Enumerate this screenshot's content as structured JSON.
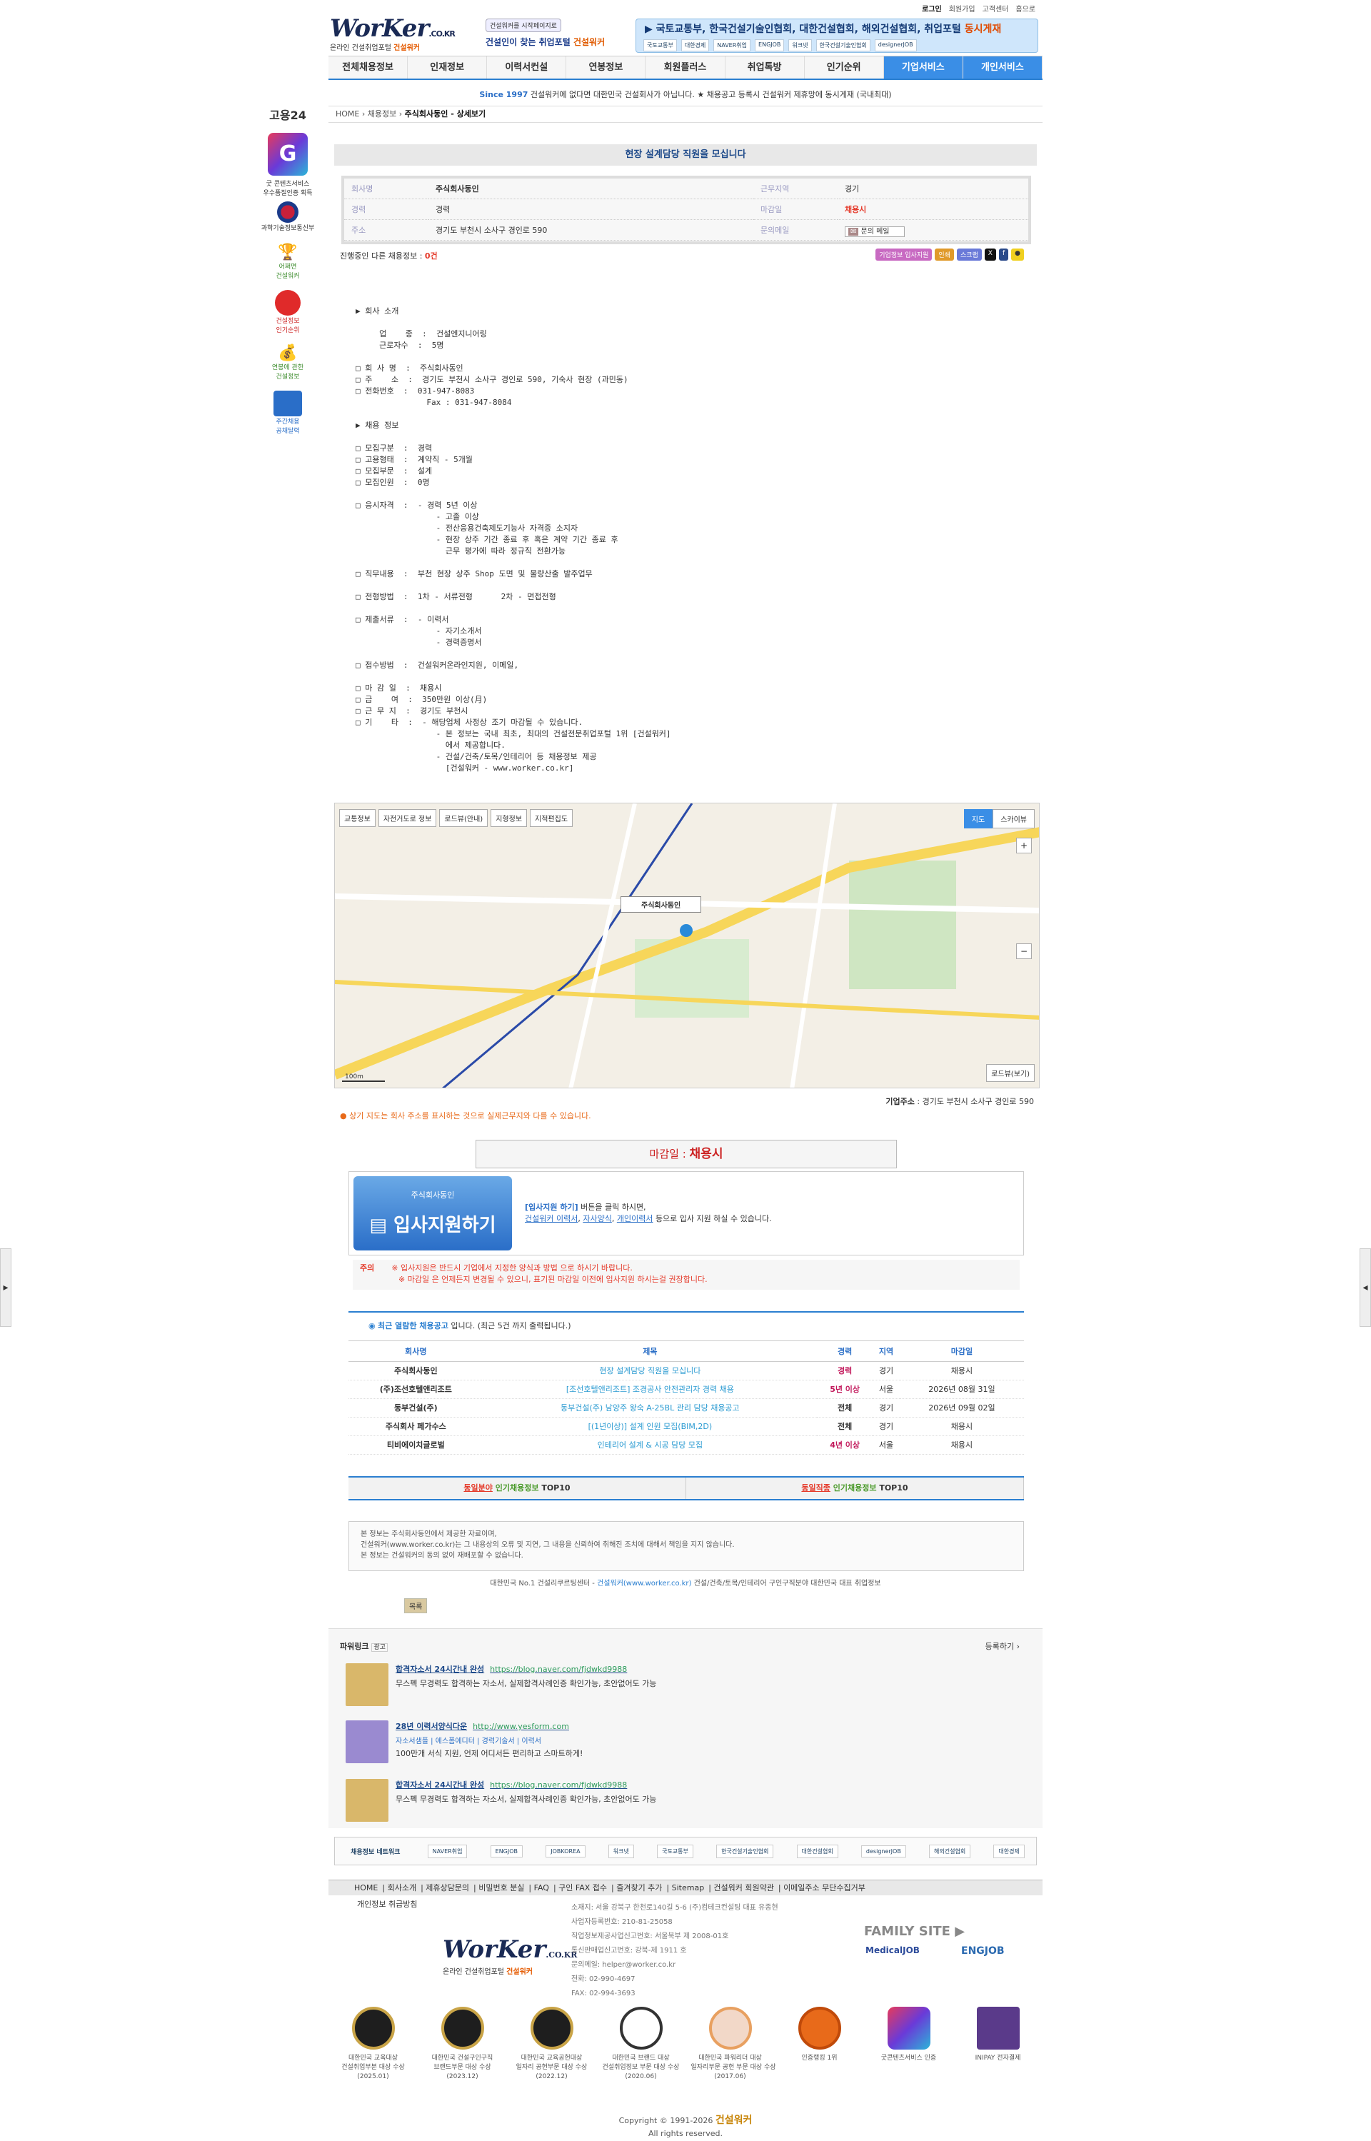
{
  "top_links": [
    "로그인",
    "회원가입",
    "고객센터",
    "홈으로"
  ],
  "logo": {
    "main": "WorKer",
    "domain": ".CO.KR",
    "sub": "온라인 건설취업포털",
    "brand": "건설워커"
  },
  "promo": {
    "badge": "건설워커를 시작페이지로",
    "line": "건설인이 찾는 취업포털",
    "brand": "건설워커"
  },
  "banner": {
    "text": "국토교통부, 한국건설기술인협회, 대한건설협회, 해외건설협회, 취업포털",
    "hl": "동시게재",
    "logos": [
      "국토교통부",
      "대한경제",
      "NAVER취업",
      "ENGJOB",
      "워크넷",
      "한국건설기술인협회",
      "designerJOB"
    ]
  },
  "gnb": [
    "전체채용정보",
    "인재정보",
    "이력서컨설",
    "연봉정보",
    "회원플러스",
    "취업톡방",
    "인기순위",
    "기업서비스",
    "개인서비스"
  ],
  "notice": {
    "since": "Since 1997",
    "text": "건설워커에 없다면 대한민국 건설회사가 아닙니다. ★ 채용공고 등록시 건설워커 제휴망에 동시게재 (국내최대)"
  },
  "breadcrumb": {
    "home": "HOME",
    "mid": "채용정보",
    "cur": "주식회사동인 - 상세보기"
  },
  "job_title": "현장 설계담당 직원을 모십니다",
  "info": {
    "company_k": "회사명",
    "company": "주식회사동인",
    "career_k": "경력",
    "career": "경력",
    "addr_k": "주소",
    "addr": "경기도 부천시 소사구 경인로 590",
    "area_k": "근무지역",
    "area": "경기",
    "deadline_k": "마감일",
    "deadline": "채용시",
    "email_k": "문의메일",
    "email": "문의 메일"
  },
  "other": {
    "label": "진행중인 다른 채용정보 :",
    "count": "0건"
  },
  "share": [
    "기업정보 입사지원",
    "인쇄",
    "스크랩"
  ],
  "content": "▶ 회사 소개\n\n     업    종  :  건설엔지니어링\n     근로자수  :  5명\n\n□ 회 사 명  :  주식회사동인\n□ 주    소  :  경기도 부천시 소사구 경인로 590, 기숙사 현장 (과민동)\n□ 전화번호  :  031-947-8083\n               Fax : 031-947-8084\n\n▶ 채용 정보\n\n□ 모집구분  :  경력\n□ 고용형태  :  계약직 - 5개월\n□ 모집부문  :  설계\n□ 모집인원  :  0명\n\n□ 응시자격  :  - 경력 5년 이상\n                 - 고졸 이상\n                 - 전산응용건축제도기능사 자격증 소지자\n                 - 현장 상주 기간 종료 후 혹은 계약 기간 종료 후\n                   근무 평가에 따라 정규직 전환가능\n\n□ 직무내용  :  부천 현장 상주 Shop 도면 및 물량산출 발주업무\n\n□ 전형방법  :  1차 - 서류전형      2차 - 면접전형\n\n□ 제출서류  :  - 이력서\n                 - 자기소개서\n                 - 경력증명서\n\n□ 접수방법  :  건설워커온라인지원, 이메일,\n\n□ 마 감 일  :  채용시\n□ 급    여  :  350만원 이상(月)\n□ 근 무 지  :  경기도 부천시\n□ 기    타  :  - 해당업체 사정상 조기 마감될 수 있습니다.\n                 - 본 정보는 국내 최초, 최대의 건설전문취업포털 1위 [건설워커]\n                   에서 제공합니다.\n                 - 건설/건축/토목/인테리어 등 채용정보 제공\n                   [건설워커 - www.worker.co.kr]",
  "map": {
    "tabs": [
      "교통정보",
      "자전거도로 정보",
      "로드뷰(안내)",
      "지형정보",
      "지적편집도"
    ],
    "types": [
      "지도",
      "스카이뷰"
    ],
    "label": "주식회사동인",
    "roadview": "로드뷰(보기)",
    "scale": "100m"
  },
  "company_addr": {
    "label": "기업주소",
    "value": "경기도 부천시 소사구 경인로 590"
  },
  "map_note": "상기 지도는 회사 주소를 표시하는 것으로 실제근무지와 다를 수 있습니다.",
  "deadline_box": {
    "label": "마감일 :",
    "value": "채용시"
  },
  "apply": {
    "company": "주식회사동인",
    "btn": "입사지원하기",
    "l1a": "[입사지원 하기]",
    "l1b": "버튼을 클릭 하시면,",
    "l2a": "건설워커 이력서",
    "l2b": "자사양식",
    "l2c": "개인이력서",
    "l2d": "등으로 입사 지원 하실 수 있습니다."
  },
  "caution": {
    "label": "주의",
    "l1": "※ 입사지원은 반드시 기업에서 지정한 양식과 방법 으로 하시기 바랍니다.",
    "l2": "※ 마감일 은 언제든지 변경될 수 있으니, 표기된 마감일 이전에 입사지원 하시는걸 권장합니다."
  },
  "recent": {
    "title": "최근 열람한 채용공고",
    "title2": "입니다.",
    "note": "(최근 5건 까지 출력됩니다.)",
    "cols": [
      "회사명",
      "제목",
      "경력",
      "지역",
      "마감일"
    ],
    "rows": [
      [
        "주식회사동인",
        "현장 설계담당 직원을 모십니다",
        "경력",
        "경기",
        "채용시"
      ],
      [
        "(주)조선호텔앤리조트",
        "[조선호텔앤리조트] 조경공사 안전관리자 경력 채용",
        "5년 이상",
        "서울",
        "2026년 08월 31일"
      ],
      [
        "동부건설(주)",
        "동부건설(주) 남양주 왕숙 A-25BL 관리 담당 채용공고",
        "전체",
        "경기",
        "2026년 09월 02일"
      ],
      [
        "주식회사 페가수스",
        "[(1년이상)] 설계 인원 모집(BIM,2D)",
        "전체",
        "경기",
        "채용시"
      ],
      [
        "티비에이치글로벌",
        "인테리어 설계 & 시공 담당 모집",
        "4년 이상",
        "서울",
        "채용시"
      ]
    ]
  },
  "top10": [
    {
      "a": "동일분야",
      "b": "인기채용정보",
      "c": "TOP10"
    },
    {
      "a": "동일직종",
      "b": "인기채용정보",
      "c": "TOP10"
    }
  ],
  "disclaimer": [
    "본 정보는 주식회사동인에서 제공한 자료이며,",
    "건설워커(www.worker.co.kr)는 그 내용상의 오류 및 지연, 그 내용을 신뢰하여 취해진 조치에 대해서 책임을 지지 않습니다.",
    "본 정보는 건설워커의 동의 없이 재배포할 수 없습니다."
  ],
  "copyline": {
    "a": "대한민국 No.1 건설리쿠르팅센터 -",
    "b": "건설워커(www.worker.co.kr)",
    "c": "건설/건축/토목/인테리어 구인구직분야 대한민국 대표 취업정보"
  },
  "list_btn": "목록",
  "powerlink": {
    "title": "파워링크",
    "ad": "광고",
    "more": "등록하기 ›",
    "items": [
      {
        "t": "합격자소서 24시간내 완성",
        "u": "https://blog.naver.com/fjdwkd9988",
        "d": "무스펙 무경력도 합격하는 자소서, 실제합격사례인증 확인가능, 초안없어도 가능"
      },
      {
        "t": "28년 이력서양식다운",
        "u": "http://www.yesform.com",
        "d": "100만개 서식 지원, 언제 어디서든 편리하고 스마트하게!",
        "s": "자소서샘플 | 에스폼에디터 | 경력기술서 | 이력서"
      },
      {
        "t": "합격자소서 24시간내 완성",
        "u": "https://blog.naver.com/fjdwkd9988",
        "d": "무스펙 무경력도 합격하는 자소서, 실제합격사례인증 확인가능, 초안없어도 가능"
      }
    ]
  },
  "partners": [
    "채용정보 네트워크",
    "NAVER취업",
    "ENGJOB",
    "JOBKOREA",
    "워크넷",
    "국토교통부",
    "한국건설기술인협회",
    "대한건설협회",
    "designerJOB",
    "해외건설협회",
    "대한경제"
  ],
  "fnav": [
    "HOME",
    "회사소개",
    "제휴상담문의",
    "비밀번호 분실",
    "FAQ",
    "구인 FAX 접수",
    "즐겨찾기 추가",
    "Sitemap",
    "건설워커 회원약관",
    "이메일주소 무단수집거부"
  ],
  "privacy": "개인정보 취급방침",
  "finfo": [
    "소재지: 서울 강북구 한천로140길 5-6 (주)컴테크컨설팅 대표 유종현",
    "사업자등록번호: 210-81-25058",
    "직업정보제공사업신고번호: 서울북부 제 2008-01호",
    "통신판매업신고번호: 강북-제 1911 호",
    "문의메일: helper@worker.co.kr",
    "전화: 02-990-4697",
    "FAX: 02-994-3693"
  ],
  "family": {
    "title": "FAMILY SITE",
    "a": "MedicalJOB",
    "b": "ENGJOB"
  },
  "awards": [
    {
      "t": "대한민국 교육대상\n건설취업부분 대상 수상\n(2025.01)"
    },
    {
      "t": "대한민국 건설구인구직\n브랜드부문 대상 수상\n(2023.12)"
    },
    {
      "t": "대한민국 교육공헌대상\n일자리 공헌부문 대상 수상\n(2022.12)"
    },
    {
      "t": "대한민국 브랜드 대상\n건설취업정보 부문 대상 수상\n(2020.06)"
    },
    {
      "t": "대한민국 파워리더 대상\n일자리부문 공헌 부문 대상 수상\n(2017.06)"
    },
    {
      "t": "인증랭킹 1위\n "
    },
    {
      "t": "굿콘텐츠서비스 인증\n "
    },
    {
      "t": "INIPAY 전자결제\n "
    }
  ],
  "copyright": {
    "a": "Copyright © 1991-2026",
    "b": "건설워커",
    "c": "All rights reserved."
  },
  "side": {
    "goy": "고용24",
    "g1": "굿 콘텐츠서비스\n우수품질인증 획득",
    "g2": "과학기술정보통신부",
    "s1": "어쩌면\n건설워커",
    "s2": "건설정보\n인기순위",
    "s3": "연봉에 관한\n건설정보",
    "s4": "주간채용\n공채달력"
  }
}
